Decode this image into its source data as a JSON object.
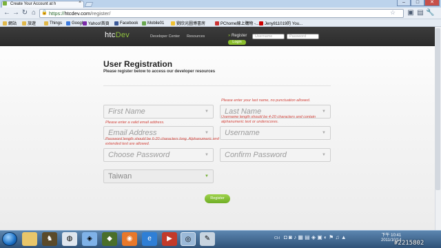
{
  "browser": {
    "tab_title": "Create Your Account at h",
    "url_scheme": "https://",
    "url_host": "htcdev.com",
    "url_path": "/register/",
    "back_icon": "back-arrow-icon",
    "forward_icon": "forward-arrow-icon",
    "reload_icon": "reload-icon",
    "home_icon": "home-icon"
  },
  "bookmarks": [
    {
      "label": "網站",
      "color": "#e0b84a"
    },
    {
      "label": "旅遊",
      "color": "#e0b84a"
    },
    {
      "label": "Things",
      "color": "#e0b84a"
    },
    {
      "label": "Google",
      "color": "#3b7be0"
    },
    {
      "label": "Yahoo!首頁",
      "color": "#7b2aa8"
    },
    {
      "label": "Facebook",
      "color": "#3b5998"
    },
    {
      "label": "Mobile01",
      "color": "#6aa84f"
    },
    {
      "label": "劉欣光圖博書房",
      "color": "#f1c232"
    },
    {
      "label": "PChome線上購物 -...",
      "color": "#cc3333"
    },
    {
      "label": "Jeny811019的 You...",
      "color": "#cc0000"
    }
  ],
  "header": {
    "logo_htc": "htc",
    "logo_dev": "Dev",
    "nav": [
      "Developer Center",
      "Resources"
    ],
    "register_label": "Register",
    "login_label": "Login",
    "username_placeholder": "Username",
    "password_placeholder": "Password"
  },
  "form": {
    "title": "User Registration",
    "subtitle": "Please register below to access our developer resources",
    "first_name_placeholder": "First Name",
    "last_name_placeholder": "Last Name",
    "email_placeholder": "Email Address",
    "username_placeholder": "Username",
    "password_placeholder": "Choose Password",
    "confirm_placeholder": "Confirm Password",
    "country_value": "Taiwan",
    "err_last_name": "Please enter your last name, no punctuation allowed.",
    "err_email": "Please enter a valid email address.",
    "err_username": "Username length should be 4-20 characters and contain alphanumeric text or underscores.",
    "err_password": "Password length should be 6-20 characters long. Alphanumeric and extended text are allowed.",
    "submit_label": "Register"
  },
  "taskbar": {
    "clock_time": "下午 10:41",
    "clock_date": "2011/10/14",
    "tray_lang": "CH",
    "watermark": "#2215802"
  }
}
